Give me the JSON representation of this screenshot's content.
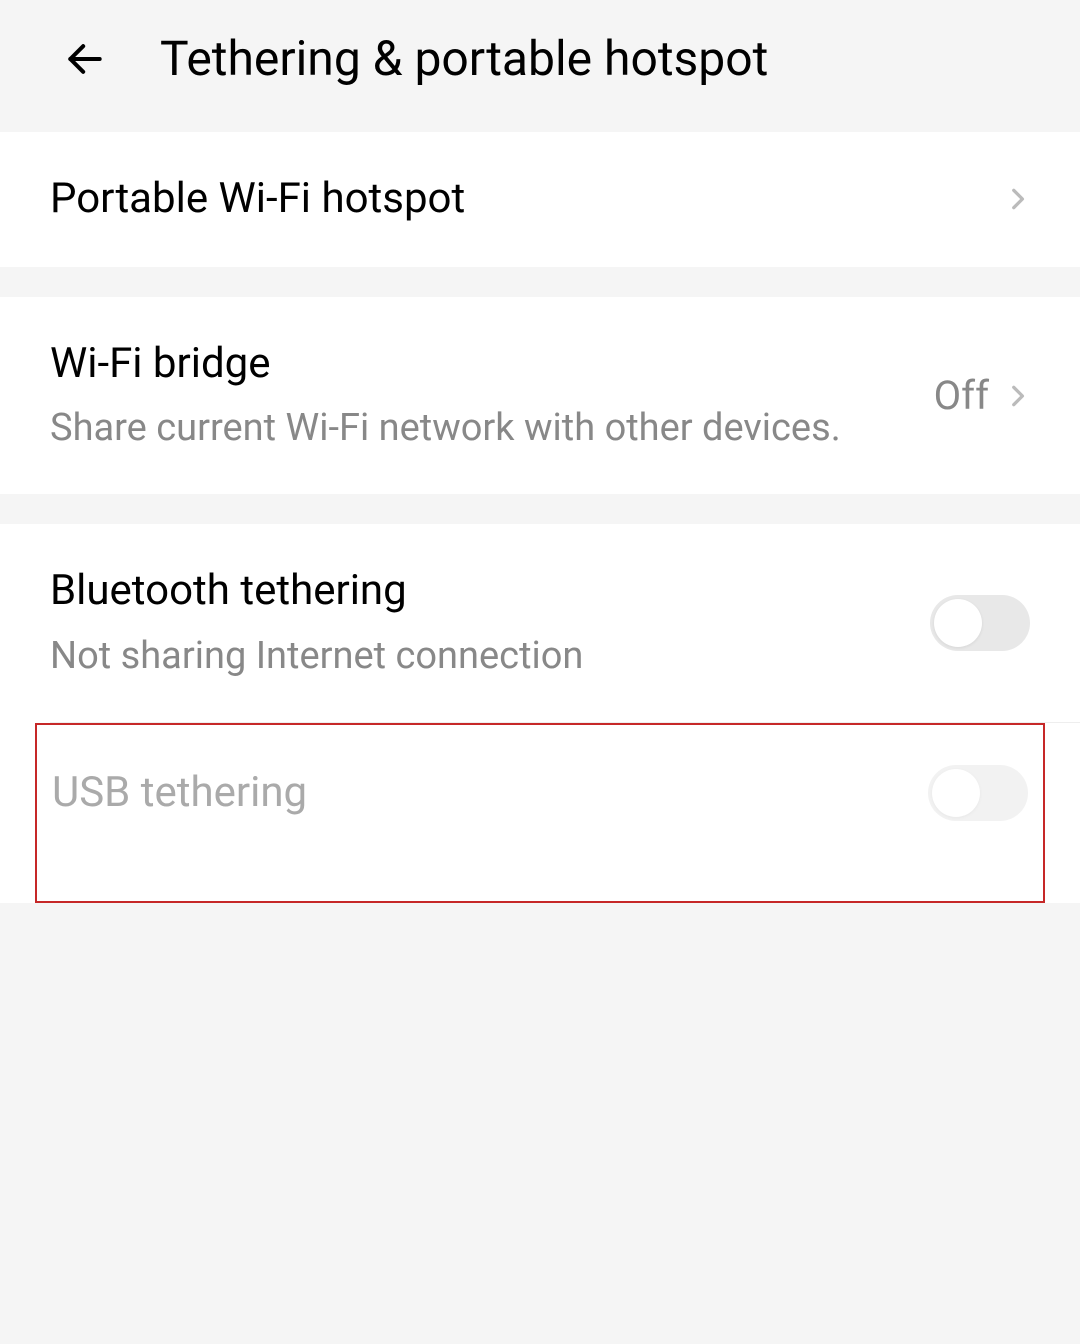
{
  "header": {
    "title": "Tethering & portable hotspot"
  },
  "items": [
    {
      "title": "Portable Wi-Fi hotspot"
    },
    {
      "title": "Wi-Fi bridge",
      "subtitle": "Share current Wi-Fi network with other devices.",
      "status": "Off"
    },
    {
      "title": "Bluetooth tethering",
      "subtitle": "Not sharing Internet connection"
    },
    {
      "title": "USB tethering"
    }
  ]
}
